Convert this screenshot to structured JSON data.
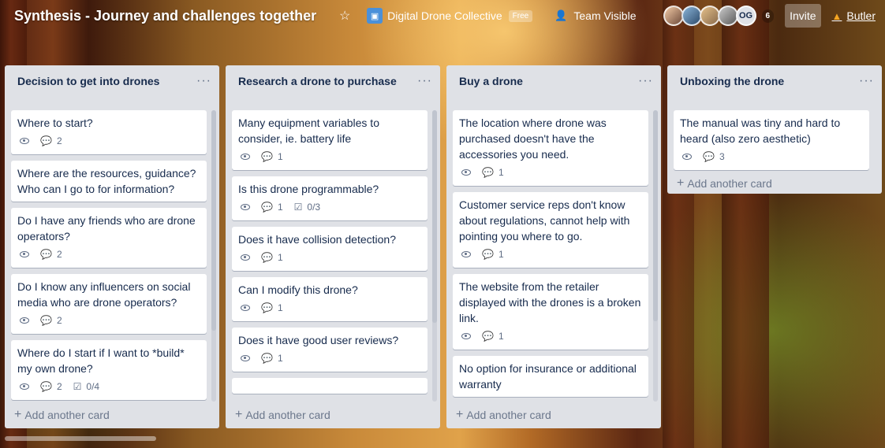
{
  "header": {
    "board_title": "Synthesis - Journey and challenges together",
    "workspace_name": "Digital Drone Collective",
    "workspace_badge": "Free",
    "visibility": "Team Visible",
    "avatar_initials": "OG",
    "member_count": "6",
    "invite_label": "Invite",
    "butler_label": "Butler"
  },
  "lists": [
    {
      "title": "Decision to get into drones",
      "menu": "···",
      "add_card": "Add another card",
      "cards": [
        {
          "title": "Where to start?",
          "comments": "2"
        },
        {
          "title": "Where are the resources, guidance? Who can I go to for information?"
        },
        {
          "title": "Do I have any friends who are drone operators?",
          "comments": "2"
        },
        {
          "title": "Do I know any influencers on social media who are drone operators?",
          "comments": "2"
        },
        {
          "title": "Where do I start if I want to *build* my own drone?",
          "comments": "2",
          "checklist": "0/4"
        }
      ]
    },
    {
      "title": "Research a drone to purchase",
      "menu": "···",
      "add_card": "Add another card",
      "cards": [
        {
          "title": "Many equipment variables to consider, ie. battery life",
          "comments": "1"
        },
        {
          "title": "Is this drone programmable?",
          "comments": "1",
          "checklist": "0/3"
        },
        {
          "title": "Does it have collision detection?",
          "comments": "1"
        },
        {
          "title": "Can I modify this drone?",
          "comments": "1"
        },
        {
          "title": "Does it have good user reviews?",
          "comments": "1"
        }
      ]
    },
    {
      "title": "Buy a drone",
      "menu": "···",
      "add_card": "Add another card",
      "cards": [
        {
          "title": "The location where drone was purchased doesn't have the accessories you need.",
          "comments": "1"
        },
        {
          "title": "Customer service reps don't know about regulations, cannot help with pointing you where to go.",
          "comments": "1"
        },
        {
          "title": "The website from the retailer displayed with the drones is a broken link.",
          "comments": "1"
        },
        {
          "title": "No option for insurance or additional warranty"
        }
      ]
    },
    {
      "title": "Unboxing the drone",
      "menu": "···",
      "add_card": "Add another card",
      "cards": [
        {
          "title": "The manual was tiny and hard to heard (also zero aesthetic)",
          "comments": "3"
        }
      ]
    }
  ],
  "icons": {
    "star": "☆",
    "comment": "💬",
    "checklist": "☑",
    "plus": "+"
  }
}
